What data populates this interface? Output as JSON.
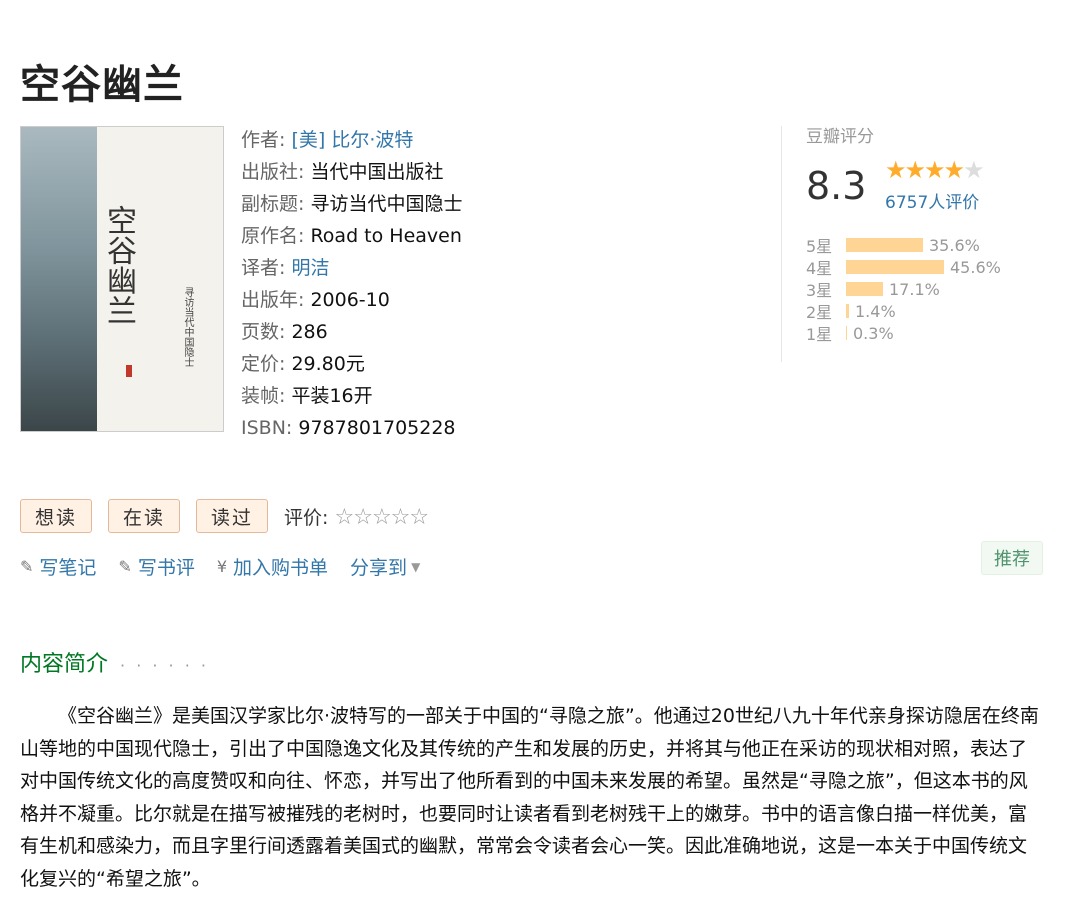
{
  "book": {
    "title": "空谷幽兰",
    "cover": {
      "title_text": "空谷幽兰",
      "subtitle_text": "寻访当代中国隐士"
    },
    "meta": [
      {
        "label": "作者:",
        "value": "[美] 比尔·波特",
        "link": true
      },
      {
        "label": "出版社:",
        "value": "当代中国出版社",
        "link": false
      },
      {
        "label": "副标题:",
        "value": "寻访当代中国隐士",
        "link": false
      },
      {
        "label": "原作名:",
        "value": "Road to Heaven",
        "link": false
      },
      {
        "label": "译者:",
        "value": "明洁",
        "link": true
      },
      {
        "label": "出版年:",
        "value": "2006-10",
        "link": false
      },
      {
        "label": "页数:",
        "value": "286",
        "link": false
      },
      {
        "label": "定价:",
        "value": "29.80元",
        "link": false
      },
      {
        "label": "装帧:",
        "value": "平装16开",
        "link": false
      },
      {
        "label": "ISBN:",
        "value": "9787801705228",
        "link": false
      }
    ]
  },
  "rating": {
    "label": "豆瓣评分",
    "score": "8.3",
    "stars_filled": 4,
    "stars_total": 5,
    "count": "6757人评价",
    "distribution": [
      {
        "label": "5星",
        "percent": "35.6%",
        "value": 35.6
      },
      {
        "label": "4星",
        "percent": "45.6%",
        "value": 45.6
      },
      {
        "label": "3星",
        "percent": "17.1%",
        "value": 17.1
      },
      {
        "label": "2星",
        "percent": "1.4%",
        "value": 1.4
      },
      {
        "label": "1星",
        "percent": "0.3%",
        "value": 0.3
      }
    ]
  },
  "actions": {
    "want": "想读",
    "reading": "在读",
    "read": "读过",
    "evaluate_label": "评价:",
    "evaluate_stars": "☆☆☆☆☆"
  },
  "links": {
    "note": "写笔记",
    "review": "写书评",
    "cart": "加入购书单",
    "share": "分享到",
    "recommend": "推荐"
  },
  "icons": {
    "pencil": "pencil-icon",
    "yen": "yen-icon",
    "caret": "caret-down-icon"
  },
  "intro": {
    "heading": "内容简介",
    "dots": "· · · · · ·",
    "text": "《空谷幽兰》是美国汉学家比尔·波特写的一部关于中国的“寻隐之旅”。他通过20世纪八九十年代亲身探访隐居在终南山等地的中国现代隐士，引出了中国隐逸文化及其传统的产生和发展的历史，并将其与他正在采访的现状相对照，表达了对中国传统文化的高度赞叹和向往、怀恋，并写出了他所看到的中国未来发展的希望。虽然是“寻隐之旅”，但这本书的风格并不凝重。比尔就是在描写被摧残的老树时，也要同时让读者看到老树残干上的嫩芽。书中的语言像白描一样优美，富有生机和感染力，而且字里行间透露着美国式的幽默，常常会令读者会心一笑。因此准确地说，这是一本关于中国传统文化复兴的“希望之旅”。"
  },
  "colors": {
    "link": "#3377aa",
    "star": "#ffac2d",
    "bar": "#ffd596",
    "section": "#007722"
  }
}
